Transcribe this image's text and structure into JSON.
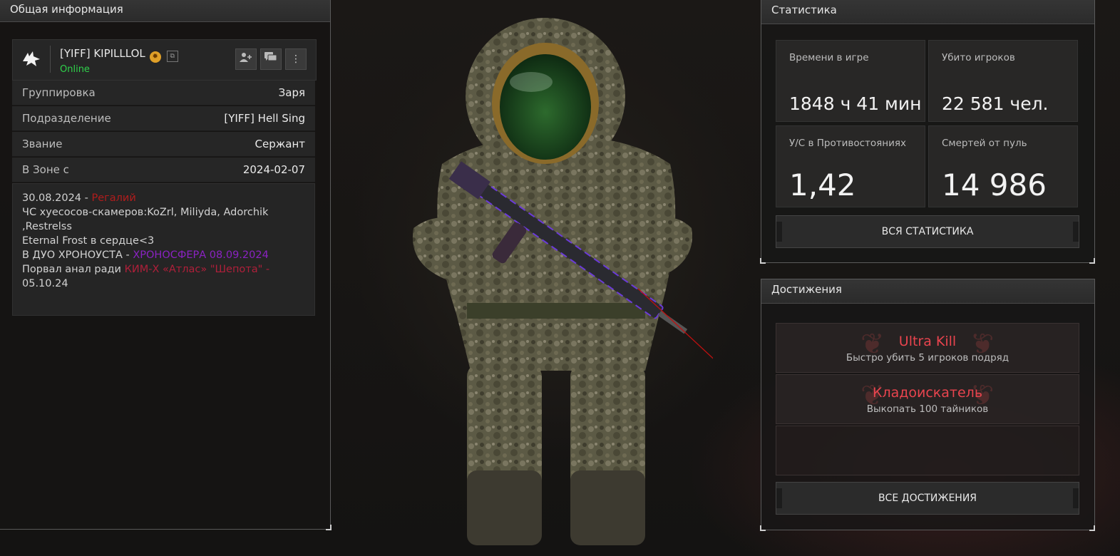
{
  "left_panel": {
    "title": "Общая информация",
    "profile": {
      "name": "[YIFF] KIPILLLOL",
      "status": "Online",
      "actions": [
        "add-friend",
        "message",
        "more"
      ]
    },
    "rows": [
      {
        "label": "Группировка",
        "value": "Заря"
      },
      {
        "label": "Подразделение",
        "value": "[YIFF] Hell Sing"
      },
      {
        "label": "Звание",
        "value": "Сержант"
      },
      {
        "label": "В Зоне с",
        "value": "2024-02-07"
      }
    ],
    "bio": {
      "l1a": "30.08.2024 - ",
      "l1b": "Регалий",
      "l2": "ЧС хуесосов-скамеров:KoZrl, Miliyda, Adorchik ,Restrelss",
      "l3": "Eternal Frost в сердце<3",
      "l4a": "В ДУО ХРОНОУСТА - ",
      "l4b": "ХРОНОСФЕРА 08.09.2024",
      "l5a": "Порвал анал ради ",
      "l5b": "КИМ-Х «Атлас» \"Шепота\" -",
      "l6": "05.10.24"
    }
  },
  "stats_panel": {
    "title": "Статистика",
    "cells": [
      {
        "label": "Времени в игре",
        "value": "1848 ч 41 мин"
      },
      {
        "label": "Убито игроков",
        "value": "22 581 чел."
      },
      {
        "label": "У/С в Противостояниях",
        "value": "1,42"
      },
      {
        "label": "Смертей от пуль",
        "value": "14 986"
      }
    ],
    "button": "ВСЯ СТАТИСТИКА"
  },
  "achievements_panel": {
    "title": "Достижения",
    "items": [
      {
        "title": "Ultra Kill",
        "desc": "Быстро убить 5 игроков подряд"
      },
      {
        "title": "Кладоискатель",
        "desc": "Выкопать 100 тайников"
      }
    ],
    "button": "ВСЕ ДОСТИЖЕНИЯ"
  },
  "colors": {
    "online": "#2fd24b",
    "achievement_title": "#e8444e",
    "bio_red": "#b11c1c",
    "bio_purple": "#8a22c2"
  }
}
